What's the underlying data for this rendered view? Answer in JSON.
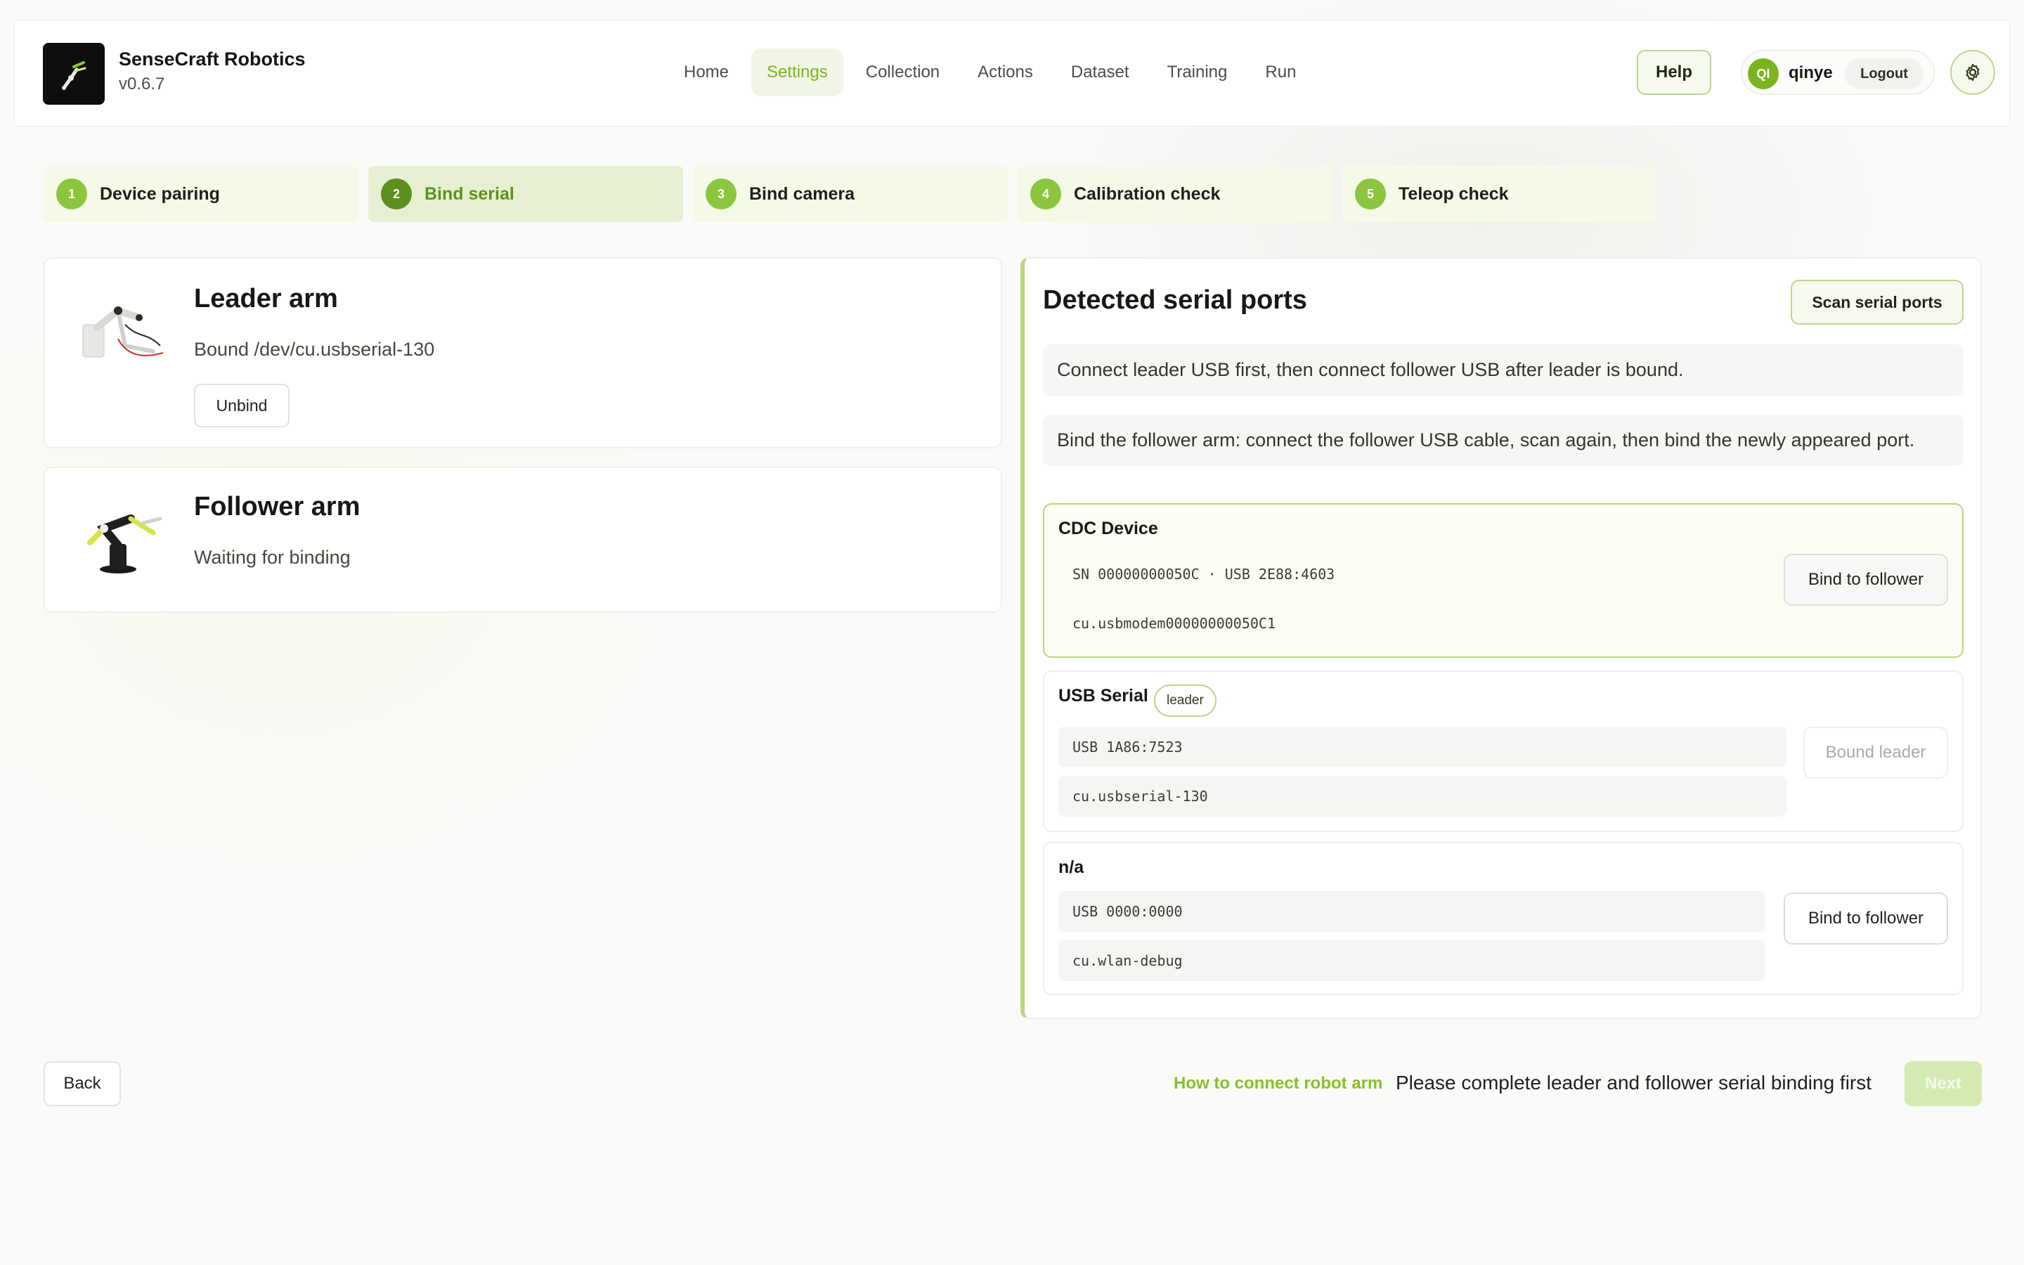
{
  "app": {
    "name": "SenseCraft Robotics",
    "version": "v0.6.7"
  },
  "nav": {
    "items": [
      {
        "label": "Home"
      },
      {
        "label": "Settings"
      },
      {
        "label": "Collection"
      },
      {
        "label": "Actions"
      },
      {
        "label": "Dataset"
      },
      {
        "label": "Training"
      },
      {
        "label": "Run"
      }
    ],
    "active": "Settings"
  },
  "header": {
    "help_label": "Help",
    "user_initials": "QI",
    "username": "qinye",
    "logout_label": "Logout",
    "settings_icon": "gear-icon"
  },
  "steps": [
    {
      "num": "1",
      "label": "Device pairing"
    },
    {
      "num": "2",
      "label": "Bind serial"
    },
    {
      "num": "3",
      "label": "Bind camera"
    },
    {
      "num": "4",
      "label": "Calibration check"
    },
    {
      "num": "5",
      "label": "Teleop check"
    }
  ],
  "active_step": "2",
  "leader": {
    "title": "Leader arm",
    "status": "Bound /dev/cu.usbserial-130",
    "unbind_label": "Unbind"
  },
  "follower": {
    "title": "Follower arm",
    "status": "Waiting for binding"
  },
  "panel": {
    "title": "Detected serial ports",
    "scan_label": "Scan serial ports",
    "note1": "Connect leader USB first, then connect follower USB after leader is bound.",
    "note2": "Bind the follower arm: connect the follower USB cable, scan again, then bind the newly appeared port.",
    "ports": [
      {
        "name": "CDC Device",
        "meta1": "SN 00000000050C · USB 2E88:4603",
        "meta2": "cu.usbmodem00000000050C1",
        "action": "Bind to follower"
      },
      {
        "name": "USB Serial",
        "badge": "leader",
        "meta1": "USB 1A86:7523",
        "meta2": "cu.usbserial-130",
        "action": "Bound leader"
      },
      {
        "name": "n/a",
        "meta1": "USB 0000:0000",
        "meta2": "cu.wlan-debug",
        "action": "Bind to follower"
      }
    ]
  },
  "footer": {
    "back_label": "Back",
    "howto_label": "How to connect robot arm",
    "message": "Please complete leader and follower serial binding first",
    "next_label": "Next"
  },
  "colors": {
    "accent": "#8cc63f",
    "accent_dark": "#5d8f1f",
    "accent_text": "#7bb41d"
  }
}
